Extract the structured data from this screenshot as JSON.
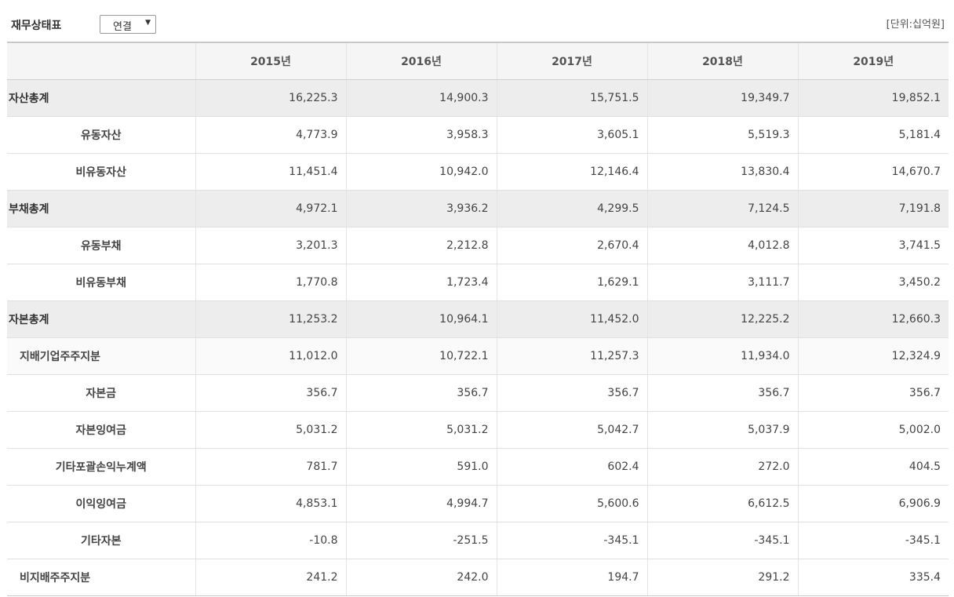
{
  "header": {
    "title": "재무상태표",
    "select_value": "연결",
    "unit": "[단위:십억원]"
  },
  "table": {
    "columns": [
      "",
      "2015년",
      "2016년",
      "2017년",
      "2018년",
      "2019년"
    ],
    "rows": [
      {
        "label": "자산총계",
        "level": "total",
        "values": [
          "16,225.3",
          "14,900.3",
          "15,751.5",
          "19,349.7",
          "19,852.1"
        ]
      },
      {
        "label": "유동자산",
        "level": "sub2",
        "values": [
          "4,773.9",
          "3,958.3",
          "3,605.1",
          "5,519.3",
          "5,181.4"
        ]
      },
      {
        "label": "비유동자산",
        "level": "sub2",
        "values": [
          "11,451.4",
          "10,942.0",
          "12,146.4",
          "13,830.4",
          "14,670.7"
        ]
      },
      {
        "label": "부채총계",
        "level": "total",
        "values": [
          "4,972.1",
          "3,936.2",
          "4,299.5",
          "7,124.5",
          "7,191.8"
        ]
      },
      {
        "label": "유동부채",
        "level": "sub2",
        "values": [
          "3,201.3",
          "2,212.8",
          "2,670.4",
          "4,012.8",
          "3,741.5"
        ]
      },
      {
        "label": "비유동부채",
        "level": "sub2",
        "values": [
          "1,770.8",
          "1,723.4",
          "1,629.1",
          "3,111.7",
          "3,450.2"
        ]
      },
      {
        "label": "자본총계",
        "level": "total",
        "values": [
          "11,253.2",
          "10,964.1",
          "11,452.0",
          "12,225.2",
          "12,660.3"
        ]
      },
      {
        "label": "지배기업주주지분",
        "level": "sub1",
        "values": [
          "11,012.0",
          "10,722.1",
          "11,257.3",
          "11,934.0",
          "12,324.9"
        ]
      },
      {
        "label": "자본금",
        "level": "sub2",
        "values": [
          "356.7",
          "356.7",
          "356.7",
          "356.7",
          "356.7"
        ]
      },
      {
        "label": "자본잉여금",
        "level": "sub2",
        "values": [
          "5,031.2",
          "5,031.2",
          "5,042.7",
          "5,037.9",
          "5,002.0"
        ]
      },
      {
        "label": "기타포괄손익누계액",
        "level": "sub2",
        "values": [
          "781.7",
          "591.0",
          "602.4",
          "272.0",
          "404.5"
        ]
      },
      {
        "label": "이익잉여금",
        "level": "sub2",
        "values": [
          "4,853.1",
          "4,994.7",
          "5,600.6",
          "6,612.5",
          "6,906.9"
        ]
      },
      {
        "label": "기타자본",
        "level": "sub2",
        "values": [
          "-10.8",
          "-251.5",
          "-345.1",
          "-345.1",
          "-345.1"
        ]
      },
      {
        "label": "비지배주주지분",
        "level": "sub1plain",
        "values": [
          "241.2",
          "242.0",
          "194.7",
          "291.2",
          "335.4"
        ]
      }
    ]
  }
}
